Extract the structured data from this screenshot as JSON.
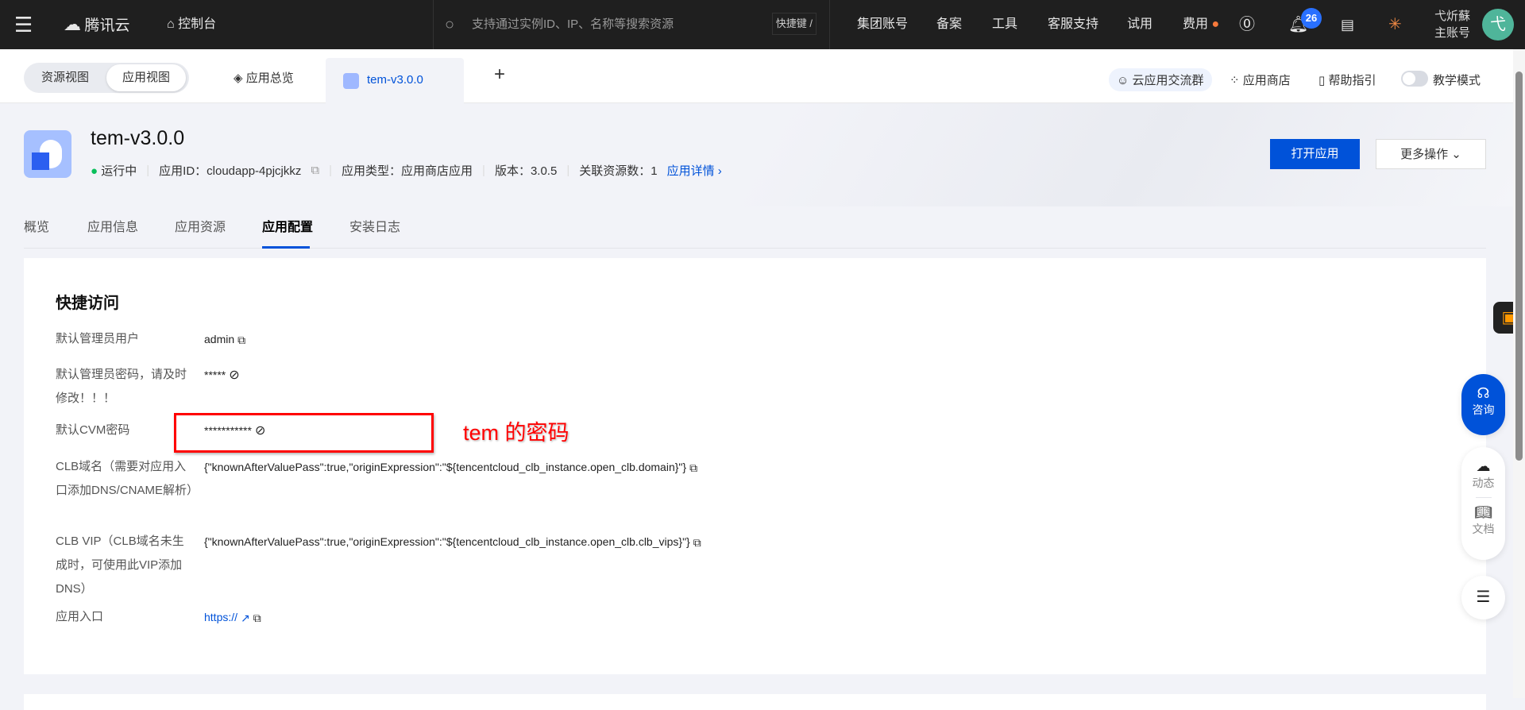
{
  "topbar": {
    "brand": "腾讯云",
    "console": "控制台",
    "search_placeholder": "支持通过实例ID、IP、名称等搜索资源",
    "shortcut": "快捷键 /",
    "nav": [
      "集团账号",
      "备案",
      "工具",
      "客服支持",
      "试用",
      "费用"
    ],
    "notif_count": "26",
    "user_name": "弋炘蘇",
    "user_role": "主账号",
    "avatar": "弋"
  },
  "subbar": {
    "view_resource": "资源视图",
    "view_app": "应用视图",
    "tab_overview": "应用总览",
    "tab_app": "tem-v3.0.0",
    "links": [
      "云应用交流群",
      "应用商店",
      "帮助指引",
      "教学模式"
    ]
  },
  "app": {
    "name": "tem-v3.0.0",
    "status": "运行中",
    "id_label": "应用ID：cloudapp-4pjcjkkz",
    "type_label": "应用类型：应用商店应用",
    "version_label": "版本：3.0.5",
    "res_label": "关联资源数：1",
    "detail_link": "应用详情",
    "open_btn": "打开应用",
    "more_btn": "更多操作"
  },
  "page_tabs": [
    "概览",
    "应用信息",
    "应用资源",
    "应用配置",
    "安装日志"
  ],
  "active_tab": "应用配置",
  "section": {
    "title": "快捷访问",
    "rows": [
      {
        "label": "默认管理员用户",
        "value": "admin"
      },
      {
        "label": "默认管理员密码，请及时修改！！！",
        "value": "*****"
      },
      {
        "label": "默认CVM密码",
        "value": "***********"
      },
      {
        "label": "CLB域名（需要对应用入口添加DNS/CNAME解析）",
        "value": "{\"knownAfterValuePass\":true,\"originExpression\":\"${tencentcloud_clb_instance.open_clb.domain}\"}"
      },
      {
        "label": "CLB VIP（CLB域名未生成时，可使用此VIP添加DNS）",
        "value": "{\"knownAfterValuePass\":true,\"originExpression\":\"${tencentcloud_clb_instance.open_clb.clb_vips}\"}"
      },
      {
        "label": "应用入口",
        "value": "https://"
      }
    ]
  },
  "annotation": "tem 的密码",
  "float": {
    "consult": "咨询",
    "news": "动态",
    "docs": "文档"
  },
  "colors": {
    "primary": "#0052d9",
    "annotation": "#ff0000",
    "running": "#0abf5b"
  }
}
